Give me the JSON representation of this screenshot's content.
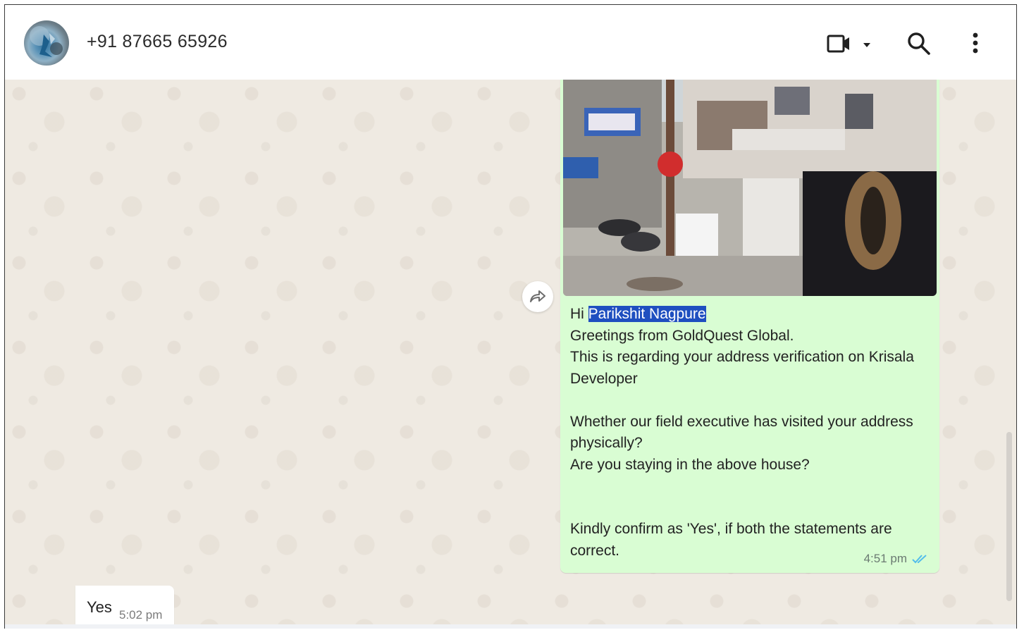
{
  "header": {
    "contact_name": "+91 87665 65926",
    "icons": [
      "video-call-icon",
      "dropdown-caret-icon",
      "search-icon",
      "more-options-icon"
    ]
  },
  "outgoing_message": {
    "greeting": "Hi ",
    "highlighted_name": "Parikshit Nagpure",
    "body": "\nGreetings from GoldQuest Global.\nThis is regarding your address verification on Krisala Developer\n\nWhether our field executive has visited your address physically?\nAre you staying in the above house?\n\n\nKindly confirm as 'Yes', if both the statements are correct.",
    "time": "4:51 pm",
    "status": "read",
    "colors": {
      "bubble": "#d9fdd3",
      "read_ticks": "#53bdeb",
      "highlight": "#1f4fc0"
    }
  },
  "incoming_message": {
    "text": "Yes",
    "time": "5:02 pm"
  },
  "colors": {
    "chat_background": "#efeae2",
    "header_background": "#ffffff"
  }
}
